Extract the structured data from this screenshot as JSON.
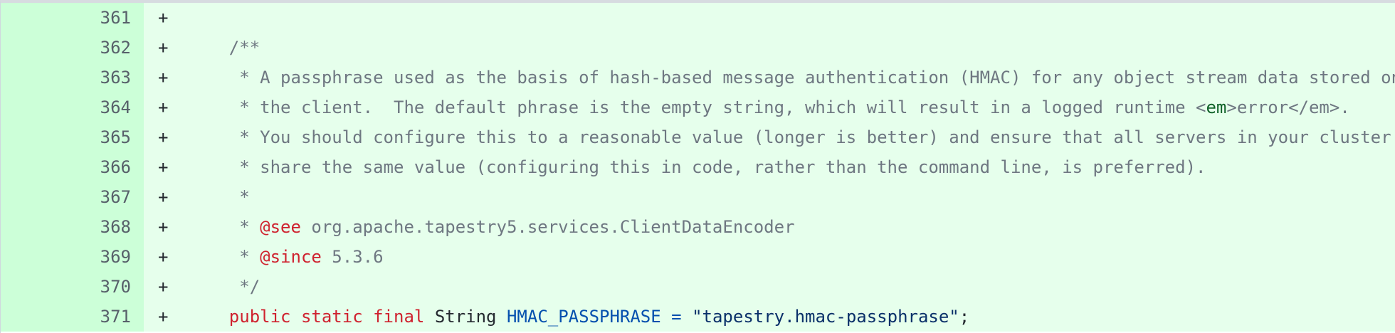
{
  "diff": {
    "marker": "+",
    "lines": [
      {
        "num": "361",
        "indent": "",
        "parts": []
      },
      {
        "num": "362",
        "indent": "    ",
        "parts": [
          {
            "cls": "comment",
            "text": "/**"
          }
        ]
      },
      {
        "num": "363",
        "indent": "     ",
        "parts": [
          {
            "cls": "comment",
            "text": "* A passphrase used as the basis of hash-based message authentication (HMAC) for any object stream data stored on"
          }
        ]
      },
      {
        "num": "364",
        "indent": "     ",
        "parts": [
          {
            "cls": "comment",
            "text": "* the client.  The default phrase is the empty string, which will result in a logged runtime <"
          },
          {
            "cls": "tag",
            "text": "em"
          },
          {
            "cls": "comment",
            "text": ">error</em>."
          }
        ]
      },
      {
        "num": "365",
        "indent": "     ",
        "parts": [
          {
            "cls": "comment",
            "text": "* You should configure this to a reasonable value (longer is better) and ensure that all servers in your cluster"
          }
        ]
      },
      {
        "num": "366",
        "indent": "     ",
        "parts": [
          {
            "cls": "comment",
            "text": "* share the same value (configuring this in code, rather than the command line, is preferred)."
          }
        ]
      },
      {
        "num": "367",
        "indent": "     ",
        "parts": [
          {
            "cls": "comment",
            "text": "*"
          }
        ]
      },
      {
        "num": "368",
        "indent": "     ",
        "parts": [
          {
            "cls": "comment",
            "text": "* "
          },
          {
            "cls": "annotation",
            "text": "@see"
          },
          {
            "cls": "comment",
            "text": " org.apache.tapestry5.services.ClientDataEncoder"
          }
        ]
      },
      {
        "num": "369",
        "indent": "     ",
        "parts": [
          {
            "cls": "comment",
            "text": "* "
          },
          {
            "cls": "annotation",
            "text": "@since"
          },
          {
            "cls": "comment",
            "text": " 5.3.6"
          }
        ]
      },
      {
        "num": "370",
        "indent": "     ",
        "parts": [
          {
            "cls": "comment",
            "text": "*/"
          }
        ]
      },
      {
        "num": "371",
        "indent": "    ",
        "parts": [
          {
            "cls": "keyword",
            "text": "public"
          },
          {
            "cls": "plain",
            "text": " "
          },
          {
            "cls": "keyword",
            "text": "static"
          },
          {
            "cls": "plain",
            "text": " "
          },
          {
            "cls": "keyword",
            "text": "final"
          },
          {
            "cls": "plain",
            "text": " "
          },
          {
            "cls": "type",
            "text": "String"
          },
          {
            "cls": "plain",
            "text": " "
          },
          {
            "cls": "constant",
            "text": "HMAC_PASSPHRASE"
          },
          {
            "cls": "plain",
            "text": " "
          },
          {
            "cls": "op",
            "text": "="
          },
          {
            "cls": "plain",
            "text": " "
          },
          {
            "cls": "string",
            "text": "\"tapestry.hmac-passphrase\""
          },
          {
            "cls": "plain",
            "text": ";"
          }
        ]
      }
    ]
  }
}
